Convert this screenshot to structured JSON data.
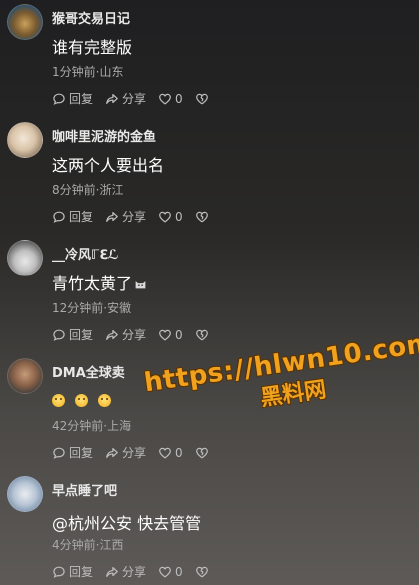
{
  "comments": [
    {
      "username": "猴哥交易日记",
      "text": "谁有完整版",
      "meta": "1分钟前·山东",
      "reply": "回复",
      "share": "分享",
      "likes": "0"
    },
    {
      "username": "咖啡里泥游的金鱼",
      "text": "这两个人要出名",
      "meta": "8分钟前·浙江",
      "reply": "回复",
      "share": "分享",
      "likes": "0"
    },
    {
      "username": "__冷风ℾℇℒ",
      "text": "青竹太黄了",
      "meta": "12分钟前·安徽",
      "reply": "回复",
      "share": "分享",
      "likes": "0"
    },
    {
      "username": "DMA全球卖",
      "text": "",
      "meta": "42分钟前·上海",
      "reply": "回复",
      "share": "分享",
      "likes": "0"
    },
    {
      "username": "早点睡了吧",
      "text": "@杭州公安 快去管管",
      "meta": "4分钟前·江西",
      "reply": "回复",
      "share": "分享",
      "likes": "0"
    }
  ],
  "watermark": {
    "url": "https://hlwn10.com",
    "sub": "黑料网"
  },
  "colors": {
    "accent": "#f0a11e",
    "meta": "#a9a9a9"
  }
}
